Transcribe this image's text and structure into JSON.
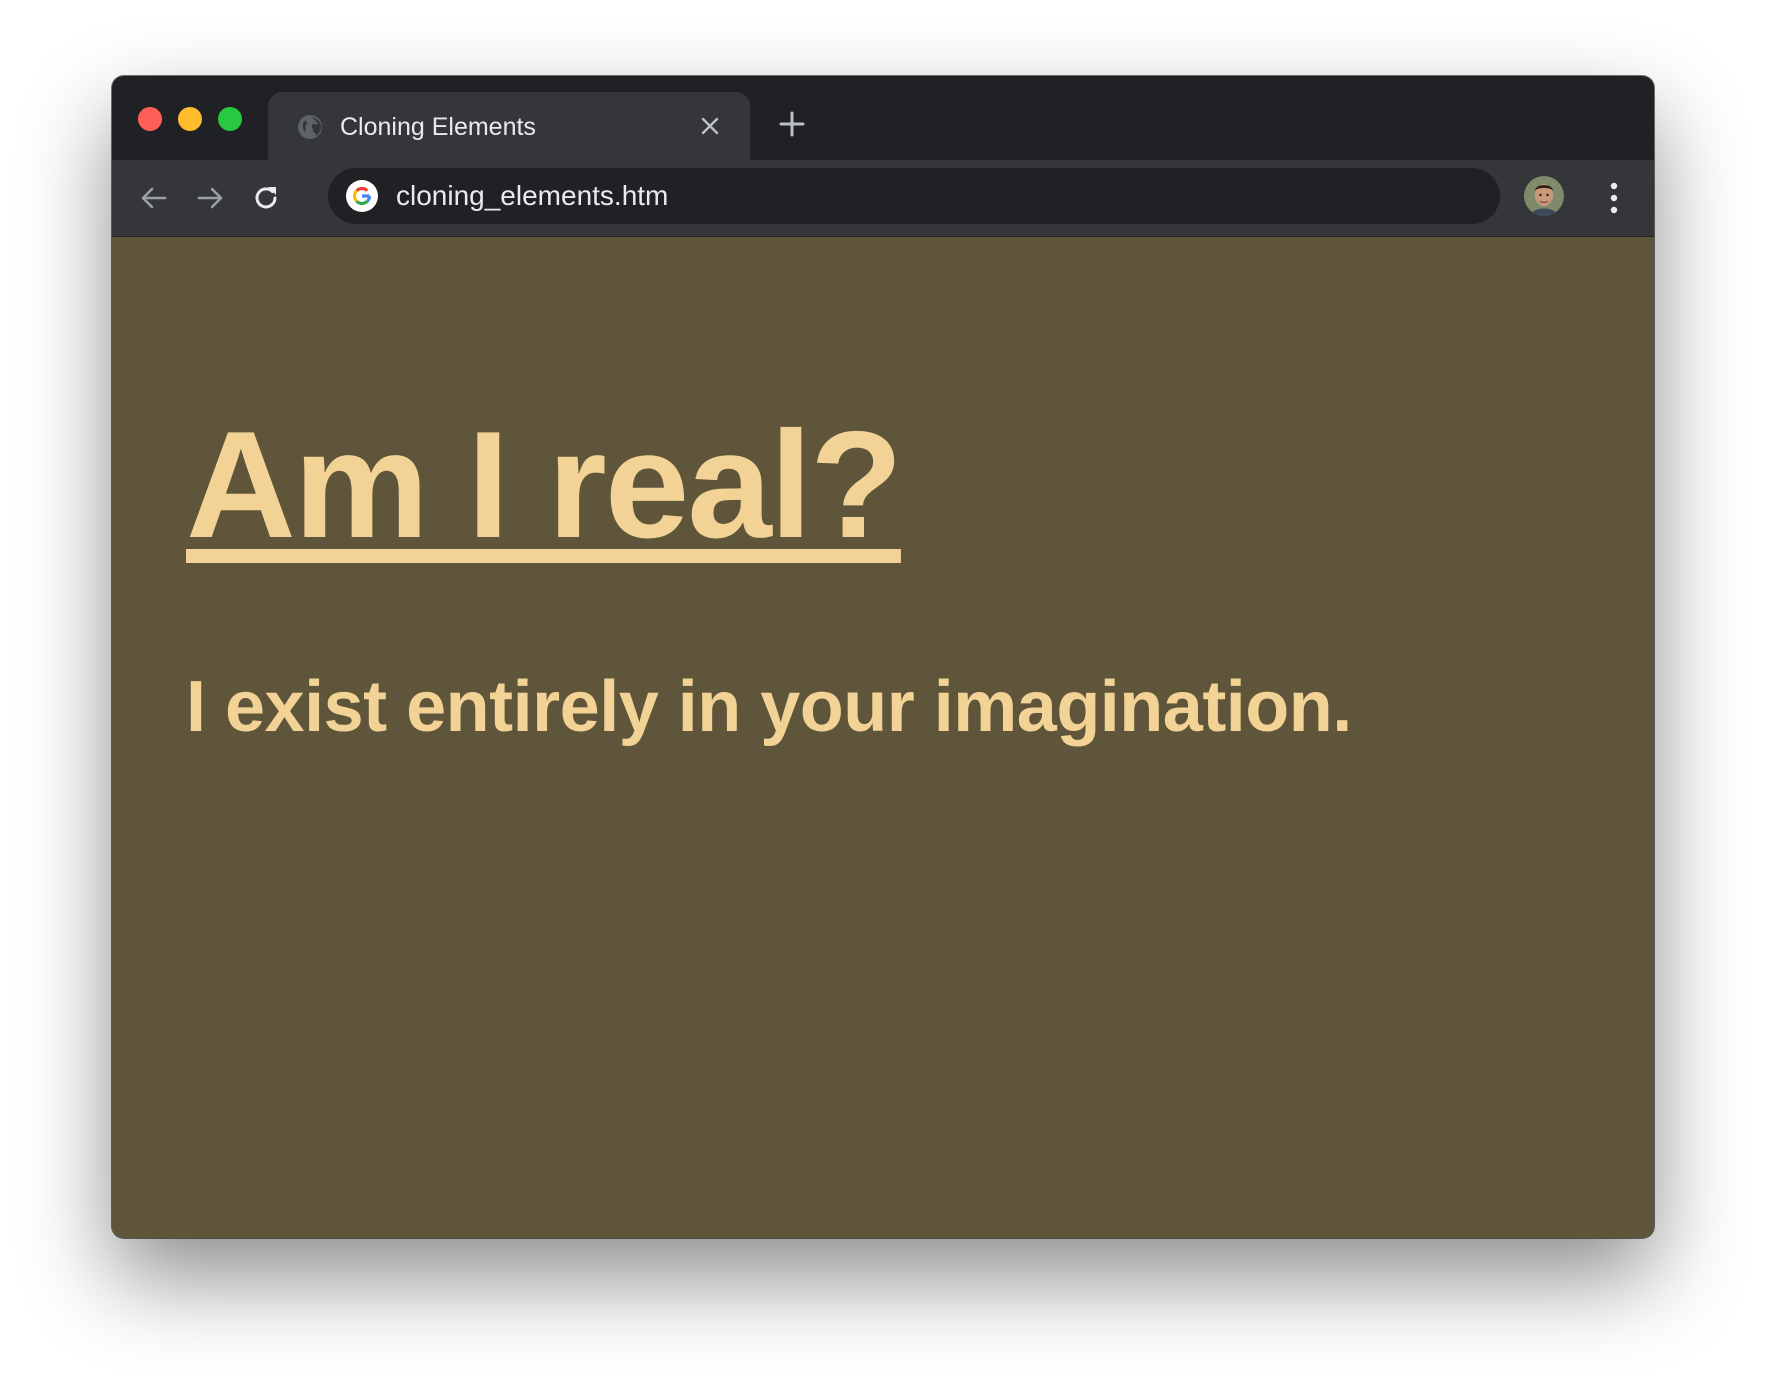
{
  "window": {
    "tab": {
      "title": "Cloning Elements",
      "favicon": "globe-icon",
      "close_icon": "close-icon"
    },
    "new_tab_icon": "plus-icon",
    "toolbar": {
      "back_icon": "arrow-left-icon",
      "forward_icon": "arrow-right-icon",
      "reload_icon": "reload-icon",
      "menu_icon": "kebab-menu-icon"
    },
    "omnibox": {
      "site_icon": "google-g-icon",
      "url": "cloning_elements.htm"
    }
  },
  "page": {
    "heading": "Am I real?",
    "subtext": "I exist entirely in your imagination."
  },
  "colors": {
    "page_background": "#5f553a",
    "text": "#f2d395",
    "tabstrip": "#202124",
    "toolbar": "#35363a"
  }
}
